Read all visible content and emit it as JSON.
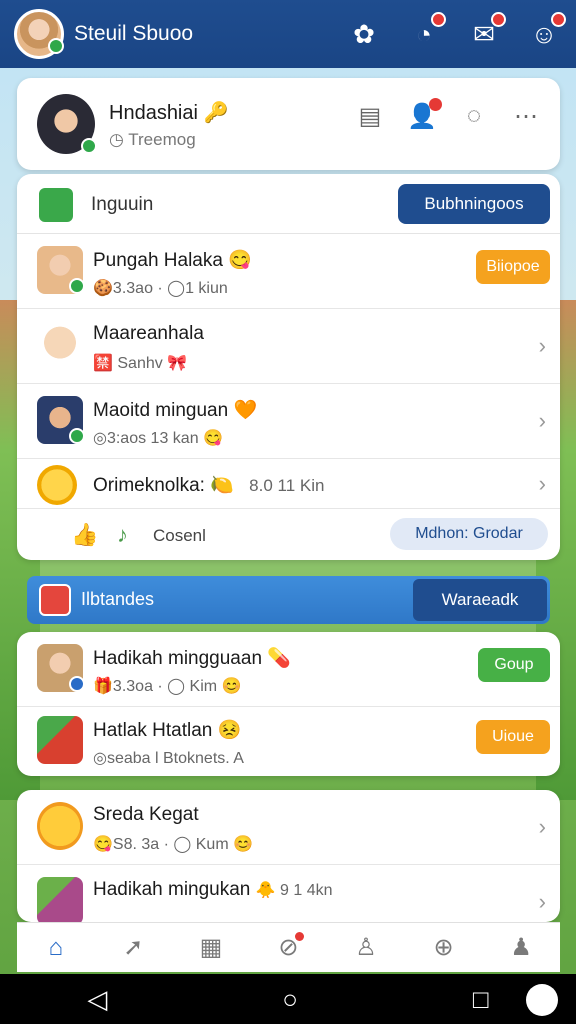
{
  "header": {
    "title": "Steuil Sbuoo",
    "icons": [
      "flower-icon",
      "notification-icon",
      "message-icon",
      "mascot-icon"
    ]
  },
  "profile": {
    "name": "Hndashiai",
    "name_emoji": "🔑",
    "subtitle": "Treemog",
    "actions": [
      "card-icon",
      "friend-request-icon",
      "chat-icon",
      "more-icon"
    ]
  },
  "section": {
    "label": "Inguuin",
    "button": "Bubhningoos"
  },
  "list": [
    {
      "title": "Pungah Halaka",
      "title_emoji": "😋",
      "sub": "🍪3.3ao · ◯1 kiun",
      "button": "Biiopoe"
    },
    {
      "title": "Maareanhala",
      "title_emoji": "",
      "sub": "🈲 Sanhv 🎀",
      "button": ""
    },
    {
      "title": "Maoitd minguan",
      "title_emoji": "🧡",
      "sub": "◎3:aos 13 kan 😋",
      "button": ""
    },
    {
      "title": "Orimeknolka:",
      "title_emoji": "🍋",
      "sub": "",
      "meta": "8.0 11 Kin",
      "button": ""
    }
  ],
  "list_footer": {
    "text": "Cosenl",
    "pill": "Mdhon: Grodar"
  },
  "banner": {
    "label": "Ilbtandes",
    "button": "Waraeadk"
  },
  "groups": [
    {
      "title": "Hadikah mingguaan",
      "title_emoji": "💊",
      "sub": "🎁3.3oa · ◯ Kim 😊",
      "button": "Goup",
      "button_color": "green"
    },
    {
      "title": "Hatlak Htatlan",
      "title_emoji": "😣",
      "sub": "◎seaba l Btoknets. A",
      "button": "Uioue",
      "button_color": "orange"
    }
  ],
  "feed": [
    {
      "title": "Sreda Kegat",
      "sub": "😋S8. 3a · ◯ Kum 😊"
    },
    {
      "title": "Hadikah mingukan",
      "title_meta": "🐥 9 1 4kn",
      "sub": ""
    }
  ],
  "bottom_nav": [
    "home-icon",
    "share-icon",
    "calendar-icon",
    "groups-icon",
    "profile-icon",
    "add-icon",
    "account-icon"
  ],
  "colors": {
    "brand": "#1f4d8f",
    "accent_blue": "#2f78c8",
    "orange": "#f5a21e",
    "green": "#47b046",
    "badge": "#e53935"
  }
}
